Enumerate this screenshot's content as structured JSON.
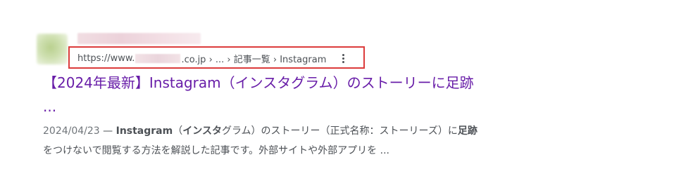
{
  "result": {
    "favicon": "site-favicon",
    "site_name": "",
    "url": {
      "prefix": "https://www.",
      "suffix": ".co.jp › ... › 記事一覧 › Instagram"
    },
    "menu_icon": "more-vert-icon",
    "title_line1": "【2024年最新】Instagram（インスタグラム）のストーリーに足跡",
    "title_line2": "...",
    "snippet": {
      "date": "2024/04/23",
      "sep": " — ",
      "b1": "Instagram",
      "t1": "（",
      "b2": "インスタ",
      "t2": "グラム）のストーリー（正式名称：ストーリーズ）に",
      "b3": "足跡",
      "t3": "をつけないで閲覧する方法を解説した記事です。外部サイトや外部アプリを ..."
    }
  },
  "colors": {
    "title_visited": "#681da8",
    "url_text": "#4d5156",
    "highlight_border": "#dc3b3b"
  }
}
